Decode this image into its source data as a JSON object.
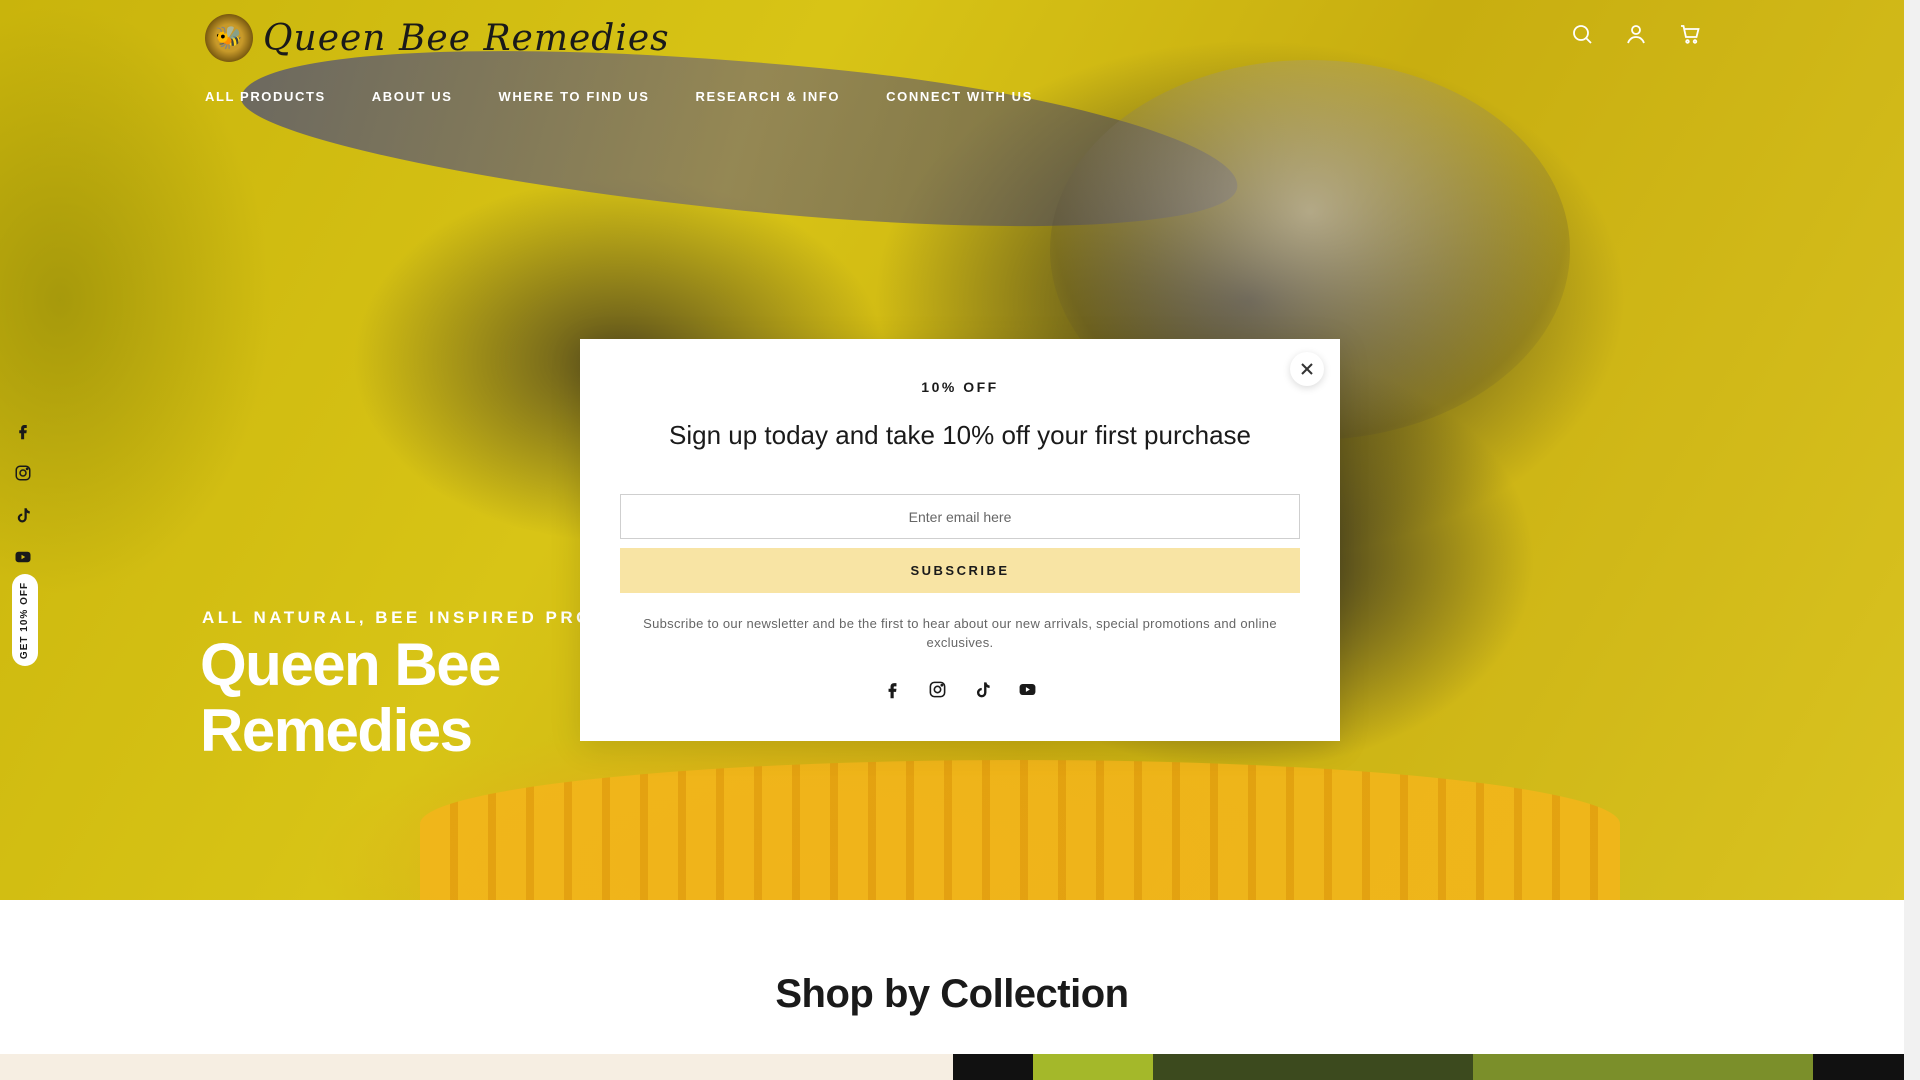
{
  "header": {
    "logo_text": "Queen Bee Remedies",
    "nav": [
      {
        "label": "ALL PRODUCTS"
      },
      {
        "label": "ABOUT US"
      },
      {
        "label": "WHERE TO FIND US"
      },
      {
        "label": "RESEARCH & INFO"
      },
      {
        "label": "CONNECT WITH US"
      }
    ],
    "icons": [
      "search-icon",
      "account-icon",
      "cart-icon"
    ]
  },
  "side_social": [
    "facebook-icon",
    "instagram-icon",
    "tiktok-icon",
    "youtube-icon"
  ],
  "side_tab_label": "GET 10% OFF",
  "hero": {
    "kicker": "ALL NATURAL, BEE INSPIRED PRODUCTS",
    "title": "Queen Bee Remedies"
  },
  "popup": {
    "kicker": "10% OFF",
    "heading": "Sign up today and take 10% off your first purchase",
    "email_placeholder": "Enter email here",
    "subscribe_label": "SUBSCRIBE",
    "note": "Subscribe to our newsletter and be the first to hear about our new arrivals, special promotions and online exclusives.",
    "social": [
      "facebook-icon",
      "instagram-icon",
      "tiktok-icon",
      "youtube-icon"
    ]
  },
  "section": {
    "title": "Shop by Collection"
  },
  "colors": {
    "accent_button": "#f8e4a4",
    "hero_yellow": "#d2bc14",
    "text_dark": "#1a1a1a"
  }
}
